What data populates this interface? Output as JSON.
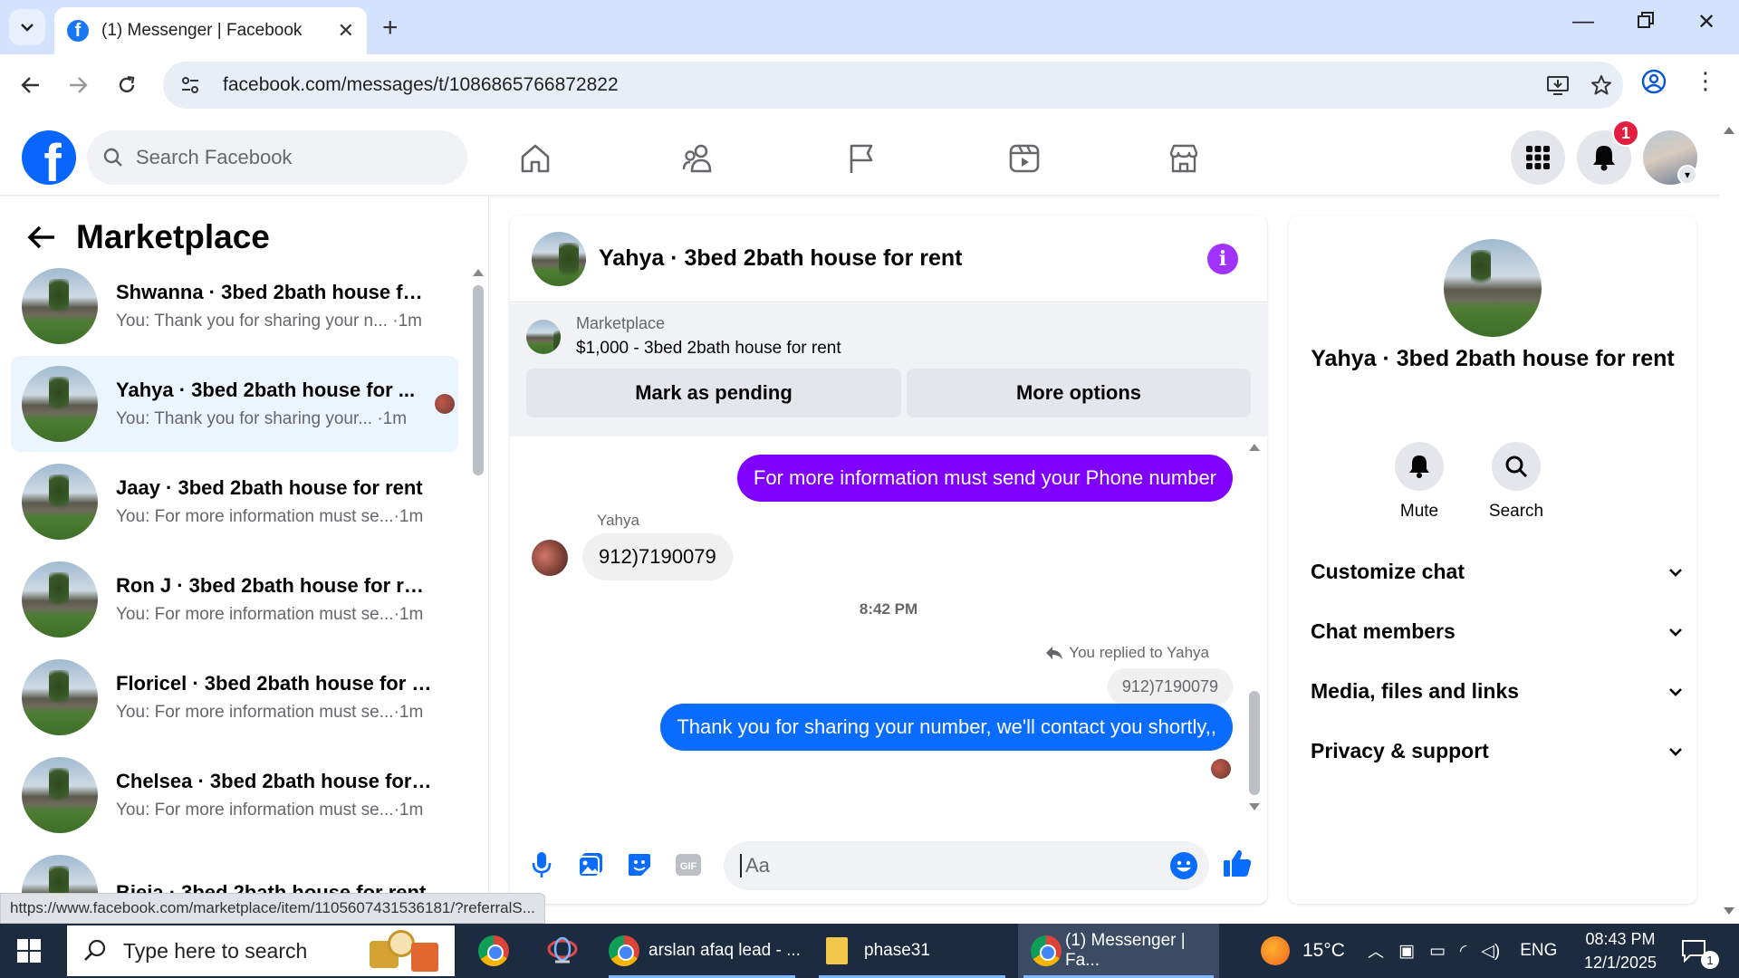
{
  "browser": {
    "tab_title": "(1) Messenger | Facebook",
    "url": "facebook.com/messages/t/1086865766872822"
  },
  "facebook": {
    "search_placeholder": "Search Facebook",
    "notification_count": "1",
    "nav_icons": [
      "home-icon",
      "friends-icon",
      "pages-flag-icon",
      "watch-video-icon",
      "marketplace-icon"
    ]
  },
  "left": {
    "title": "Marketplace",
    "conversations": [
      {
        "name": "Shwanna · 3bed 2bath house for...",
        "preview": "You: Thank you for sharing your n...",
        "time": " ·1m"
      },
      {
        "name": "Yahya · 3bed 2bath house for ...",
        "preview": "You: Thank you for sharing your...",
        "time": " ·1m"
      },
      {
        "name": "Jaay · 3bed 2bath house for rent",
        "preview": "You: For more information must se...",
        "time": "·1m"
      },
      {
        "name": "Ron J · 3bed 2bath house for rent",
        "preview": "You: For more information must se...",
        "time": "·1m"
      },
      {
        "name": "Floricel · 3bed 2bath house for r...",
        "preview": "You: For more information must se...",
        "time": "·1m"
      },
      {
        "name": "Chelsea · 3bed 2bath house for r...",
        "preview": "You: For more information must se...",
        "time": "·1m"
      },
      {
        "name": "Bieja · 3bed 2bath house for rent",
        "preview": "",
        "time": ""
      }
    ]
  },
  "chat": {
    "title": "Yahya · 3bed 2bath house for rent",
    "listing_label": "Marketplace",
    "listing_title": "$1,000 - 3bed 2bath house for rent",
    "pending_button": "Mark as pending",
    "more_button": "More options",
    "msg_out_1": "For more information must send your Phone number",
    "sender_name": "Yahya",
    "msg_in_1": "912)7190079",
    "timestamp": "8:42 PM",
    "replied_to": "You replied to Yahya",
    "quoted_text": "912)7190079",
    "msg_out_2": "Thank you for sharing your number, we'll contact you shortly,,",
    "composer_placeholder": "Aa",
    "accent_color": "#7f00ff"
  },
  "right": {
    "name": "Yahya · 3bed 2bath house for rent",
    "mute_label": "Mute",
    "search_label": "Search",
    "sections": [
      "Customize chat",
      "Chat members",
      "Media, files and links",
      "Privacy & support"
    ]
  },
  "status_link": "https://www.facebook.com/marketplace/item/1105607431536181/?referralS...",
  "taskbar": {
    "search_placeholder": "Type here to search",
    "app_1": "arslan afaq lead - ...",
    "app_2": "phase31",
    "app_3": "(1) Messenger | Fa...",
    "temperature": "15°C",
    "language": "ENG",
    "time": "08:43 PM",
    "date": "12/1/2025",
    "notif_count": "1"
  }
}
